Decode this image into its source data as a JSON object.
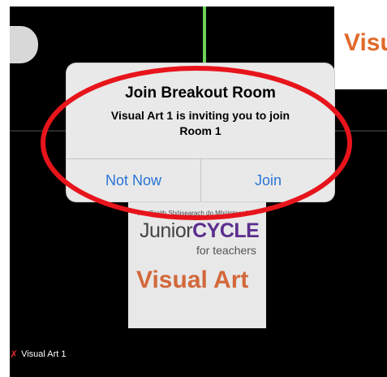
{
  "dialog": {
    "title": "Join Breakout Room",
    "message_line1": "Visual Art 1 is inviting you to join",
    "message_line2": "Room 1",
    "not_now_label": "Not Now",
    "join_label": "Join"
  },
  "background": {
    "top_right_tile_text": "Visu",
    "card": {
      "irish_text": "An tSraith Shóisearach do Mhúinteoirí",
      "brand_part1": "Junior",
      "brand_part2": "CYCLE",
      "brand_sub": "for teachers",
      "title": "Visual Art"
    },
    "participant_name": "Visual Art 1"
  },
  "colors": {
    "button_text": "#2a74d6",
    "annotation": "#e8141b",
    "active_speaker": "#6fd35a"
  }
}
